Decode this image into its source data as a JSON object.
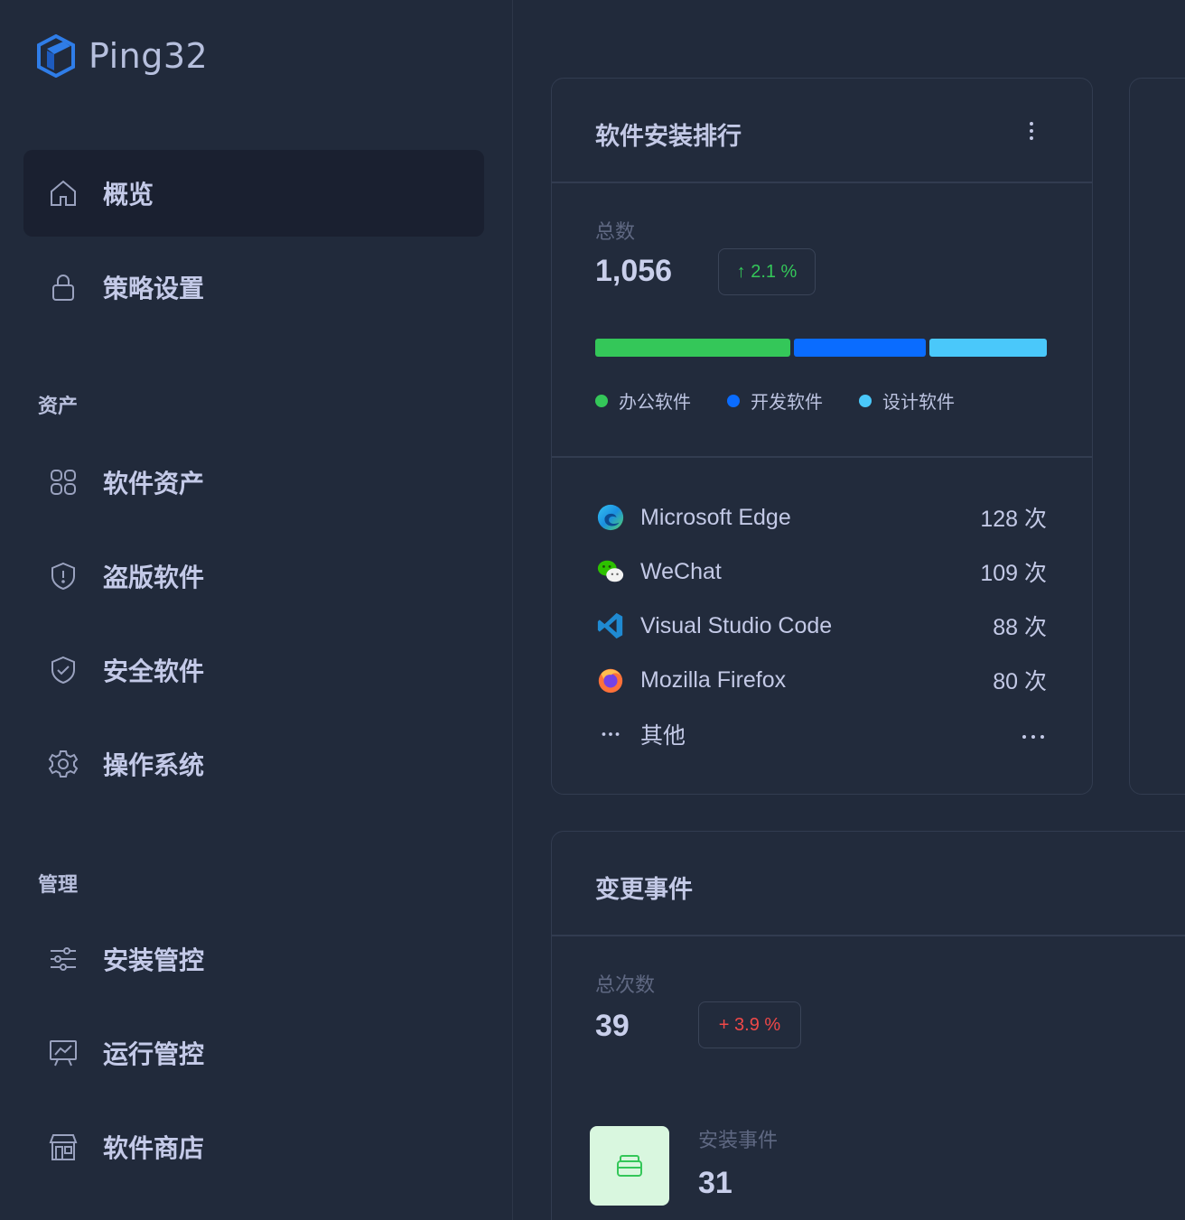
{
  "brand": {
    "name": "Ping32"
  },
  "nav": {
    "overview": "概览",
    "policy": "策略设置",
    "section_assets": "资产",
    "software_assets": "软件资产",
    "pirated_software": "盗版软件",
    "security_software": "安全软件",
    "operating_system": "操作系统",
    "section_manage": "管理",
    "install_control": "安装管控",
    "run_control": "运行管控",
    "software_store": "软件商店"
  },
  "ranking_card": {
    "title": "软件安装排行",
    "total_label": "总数",
    "total_value": "1,056",
    "change": "↑ 2.1 %",
    "distribution": [
      {
        "name": "办公软件",
        "share": 0.44,
        "color": "#34c759"
      },
      {
        "name": "开发软件",
        "share": 0.3,
        "color": "#0a6cff"
      },
      {
        "name": "设计软件",
        "share": 0.26,
        "color": "#4ac8fa"
      }
    ],
    "apps": [
      {
        "name": "Microsoft Edge",
        "count": "128 次",
        "icon": "edge-icon"
      },
      {
        "name": "WeChat",
        "count": "109 次",
        "icon": "wechat-icon"
      },
      {
        "name": "Visual Studio Code",
        "count": "88 次",
        "icon": "vscode-icon"
      },
      {
        "name": "Mozilla Firefox",
        "count": "80 次",
        "icon": "firefox-icon"
      }
    ],
    "others_label": "其他"
  },
  "events_card": {
    "title": "变更事件",
    "total_label": "总次数",
    "total_value": "39",
    "change": "+ 3.9 %",
    "install_label": "安装事件",
    "install_value": "31"
  },
  "colors": {
    "accent_green": "#34c759",
    "accent_blue": "#0a6cff",
    "accent_cyan": "#4ac8fa",
    "negative_red": "#f04848"
  }
}
